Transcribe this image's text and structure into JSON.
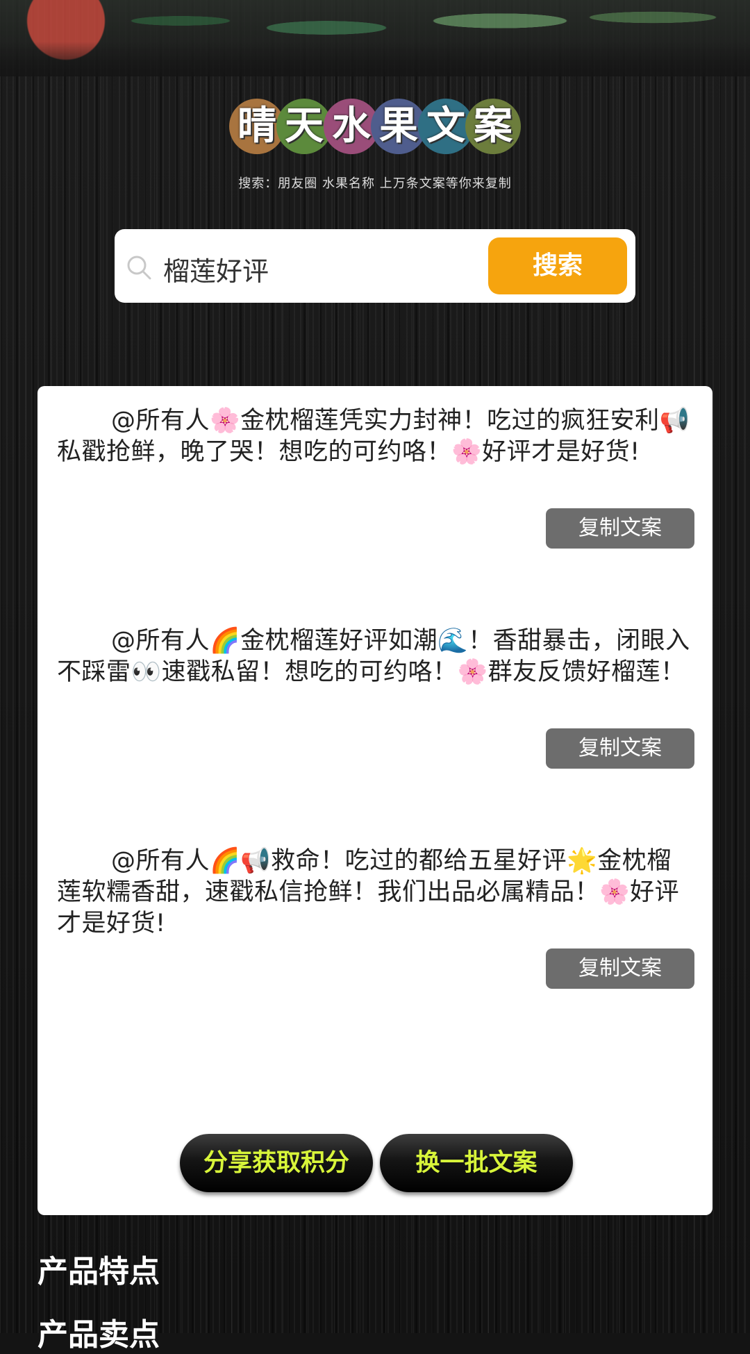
{
  "logo": {
    "chars": [
      {
        "c": "晴",
        "color": "#a8743f"
      },
      {
        "c": "天",
        "color": "#5c8a3c"
      },
      {
        "c": "水",
        "color": "#9a4d79"
      },
      {
        "c": "果",
        "color": "#4f5d8d"
      },
      {
        "c": "文",
        "color": "#2f6f84"
      },
      {
        "c": "案",
        "color": "#6c7d3c"
      }
    ]
  },
  "subtitle": "搜索：朋友圈   水果名称 上万条文案等你来复制",
  "search": {
    "value": "榴莲好评",
    "button_label": "搜索"
  },
  "copies": [
    {
      "text": "@所有人🌸金枕榴莲凭实力封神！吃过的疯狂安利📢私戳抢鲜，晚了哭！想吃的可约咯！🌸好评才是好货!",
      "button": "复制文案"
    },
    {
      "text": "@所有人🌈金枕榴莲好评如潮🌊！香甜暴击，闭眼入不踩雷👀速戳私留！想吃的可约咯！🌸群友反馈好榴莲！",
      "button": "复制文案"
    },
    {
      "text": "@所有人🌈📢救命！吃过的都给五星好评🌟金枕榴莲软糯香甜，速戳私信抢鲜！我们出品必属精品！🌸好评才是好货!",
      "button": "复制文案"
    }
  ],
  "actions": {
    "share": "分享获取积分",
    "refresh": "换一批文案"
  },
  "sections": {
    "features": "产品特点",
    "selling": "产品卖点"
  }
}
